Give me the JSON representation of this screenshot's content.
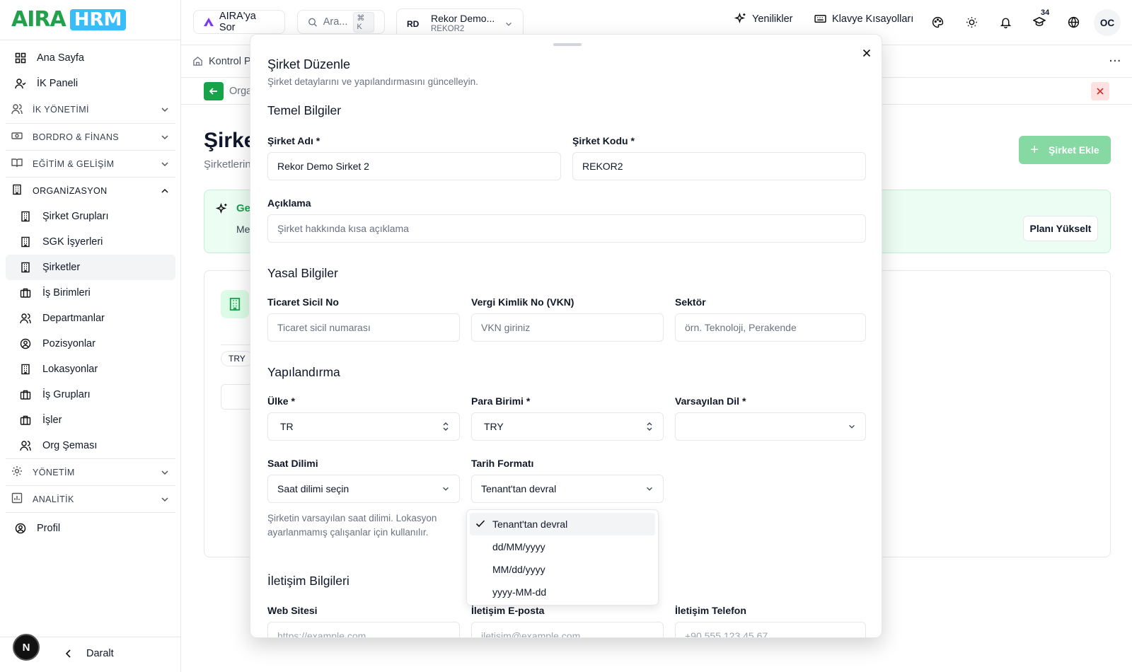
{
  "brand": {
    "aira": "AIRA",
    "hrm": "HRM"
  },
  "sidebar": {
    "home": "Ana Sayfa",
    "hr_panel": "İK Paneli",
    "sections": {
      "hr": "İK YÖNETİMİ",
      "payroll": "BORDRO & FİNANS",
      "training": "EĞİTİM & GELİŞİM",
      "org": "ORGANİZASYON",
      "admin": "YÖNETİM",
      "analytics": "ANALİTİK"
    },
    "org_items": [
      "Şirket Grupları",
      "SGK İşyerleri",
      "Şirketler",
      "İş Birimleri",
      "Departmanlar",
      "Pozisyonlar",
      "Lokasyonlar",
      "İş Grupları",
      "İşler",
      "Org Şeması"
    ],
    "profile": "Profil",
    "collapse": "Daralt",
    "n_badge": "N"
  },
  "topbar": {
    "ask": "AIRA'ya Sor",
    "search_placeholder": "Ara...",
    "shortcut": "⌘ K",
    "company_initials": "RD",
    "company_name": "Rekor Demo...",
    "company_code": "REKOR2",
    "news": "Yenilikler",
    "shortcuts": "Klavye Kısayolları",
    "notif_count": "34",
    "user_initials": "OC"
  },
  "background": {
    "crumb": "Kontrol P",
    "org": "Orga",
    "title": "Şirke",
    "subtitle": "Şirketlerin",
    "add_button": "Şirket Ekle",
    "promo_ge": "Ge",
    "promo_me": "Me",
    "upgrade": "Planı Yükselt",
    "currency_pill": "TRY"
  },
  "modal": {
    "title": "Şirket Düzenle",
    "description": "Şirket detaylarını ve yapılandırmasını güncelleyin.",
    "sections": {
      "basic": "Temel Bilgiler",
      "legal": "Yasal Bilgiler",
      "config": "Yapılandırma",
      "contact": "İletişim Bilgileri"
    },
    "fields": {
      "name_label": "Şirket Adı *",
      "name_value": "Rekor Demo Sirket 2",
      "code_label": "Şirket Kodu *",
      "code_value": "REKOR2",
      "desc_label": "Açıklama",
      "desc_placeholder": "Şirket hakkında kısa açıklama",
      "trade_label": "Ticaret Sicil No",
      "trade_placeholder": "Ticaret sicil numarası",
      "vkn_label": "Vergi Kimlik No (VKN)",
      "vkn_placeholder": "VKN giriniz",
      "sector_label": "Sektör",
      "sector_placeholder": "örn. Teknoloji, Perakende",
      "country_label": "Ülke *",
      "country_value": "TR",
      "currency_label": "Para Birimi *",
      "currency_value": "TRY",
      "lang_label": "Varsayılan Dil *",
      "lang_value": "",
      "tz_label": "Saat Dilimi",
      "tz_value": "Saat dilimi seçin",
      "tz_help": "Şirketin varsayılan saat dilimi. Lokasyon ayarlanmamış çalışanlar için kullanılır.",
      "date_label": "Tarih Formatı",
      "date_value": "Tenant'tan devral",
      "web_label": "Web Sitesi",
      "web_placeholder": "https://example.com",
      "email_label": "İletişim E-posta",
      "email_placeholder": "iletisim@example.com",
      "phone_label": "İletişim Telefon",
      "phone_placeholder": "+90 555 123 45 67"
    },
    "date_options": [
      "Tenant'tan devral",
      "dd/MM/yyyy",
      "MM/dd/yyyy",
      "yyyy-MM-dd"
    ]
  },
  "colors": {
    "brand_green": "#22a04a",
    "hrm_blue": "#38bdf8",
    "accent_green": "#16a34a"
  }
}
